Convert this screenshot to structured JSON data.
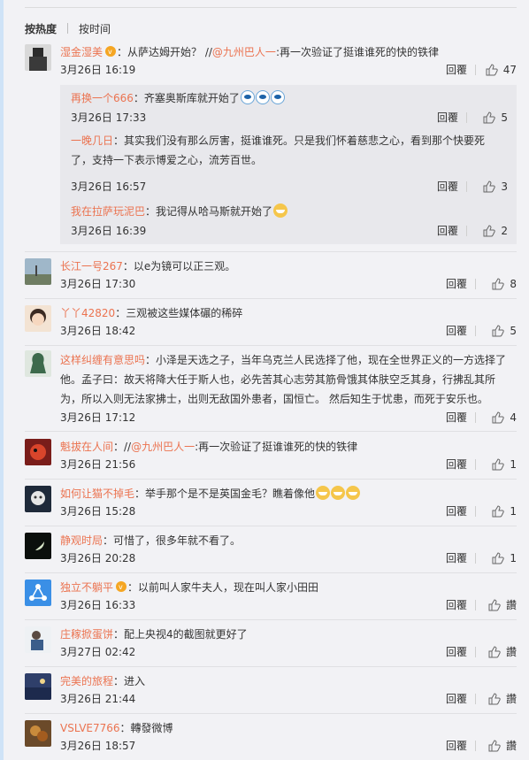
{
  "sort": {
    "hot": "按热度",
    "time": "按时间"
  },
  "actions": {
    "reply": "回覆"
  },
  "comments": [
    {
      "user": "湿金湿美",
      "text": "：从萨达姆开始？ //",
      "mention": "@九州巴人一",
      "text2": ":再一次验证了挺谁谁死的快的铁律",
      "time": "3月26日 16:19",
      "likes": "47"
    },
    {
      "user": "长江一号267",
      "text": "：以e为镜可以正三观。",
      "time": "3月26日 17:30",
      "likes": "8"
    },
    {
      "user": "丫丫42820",
      "text": "：三观被这些媒体碾的稀碎",
      "time": "3月26日 18:42",
      "likes": "5"
    },
    {
      "user": "这样纠缠有意思吗",
      "text": "：小泽是天选之子，当年乌克兰人民选择了他，现在全世界正义的一方选择了他。孟子曰：故天将降大任于斯人也，必先苦其心志劳其筋骨饿其体肤空乏其身，行拂乱其所为，所以入则无法家拂士，出则无敌国外患者，国恒亡。 然后知生于忧患，而死于安乐也。",
      "time": "3月26日 17:12",
      "likes": "4"
    },
    {
      "user": "魁拔在人间",
      "text": "：//",
      "mention": "@九州巴人一",
      "text2": ":再一次验证了挺谁谁死的快的铁律",
      "time": "3月26日 21:56",
      "likes": "1"
    },
    {
      "user": "如何让猫不掉毛",
      "text": "：举手那个是不是英国金毛？瞧着像他",
      "time": "3月26日 15:28",
      "likes": "1"
    },
    {
      "user": "静观时局",
      "text": "：可惜了，很多年就不看了。",
      "time": "3月26日 20:28",
      "likes": "1"
    },
    {
      "user": "独立不躺平",
      "text": "：以前叫人家牛夫人，现在叫人家小田田",
      "time": "3月26日 16:33",
      "likes": "讚"
    },
    {
      "user": "庄稼掀蛋饼",
      "text": "：配上央视4的截图就更好了",
      "time": "3月27日 02:42",
      "likes": "讚"
    },
    {
      "user": "完美的旅程",
      "text": "：进入",
      "time": "3月26日 21:44",
      "likes": "讚"
    },
    {
      "user": "VSLVE7766",
      "text": "：轉發微博",
      "time": "3月26日 18:57",
      "likes": "讚"
    }
  ],
  "replies": [
    {
      "user": "再换一个666",
      "text": "：齐塞奥斯库就开始了",
      "time": "3月26日 17:33",
      "likes": "5"
    },
    {
      "user": "一晚几日",
      "text": "：其实我们没有那么厉害，挺谁谁死。只是我们怀着慈悲之心，看到那个快要死了，支持一下表示博爱之心，流芳百世。",
      "time": "3月26日 16:57",
      "likes": "3"
    },
    {
      "user": "我在拉萨玩泥巴",
      "text": "：我记得从哈马斯就开始了",
      "time": "3月26日 16:39",
      "likes": "2"
    }
  ],
  "colors": {
    "username": "#eb7350",
    "accent_border": "#cfe3f7"
  }
}
